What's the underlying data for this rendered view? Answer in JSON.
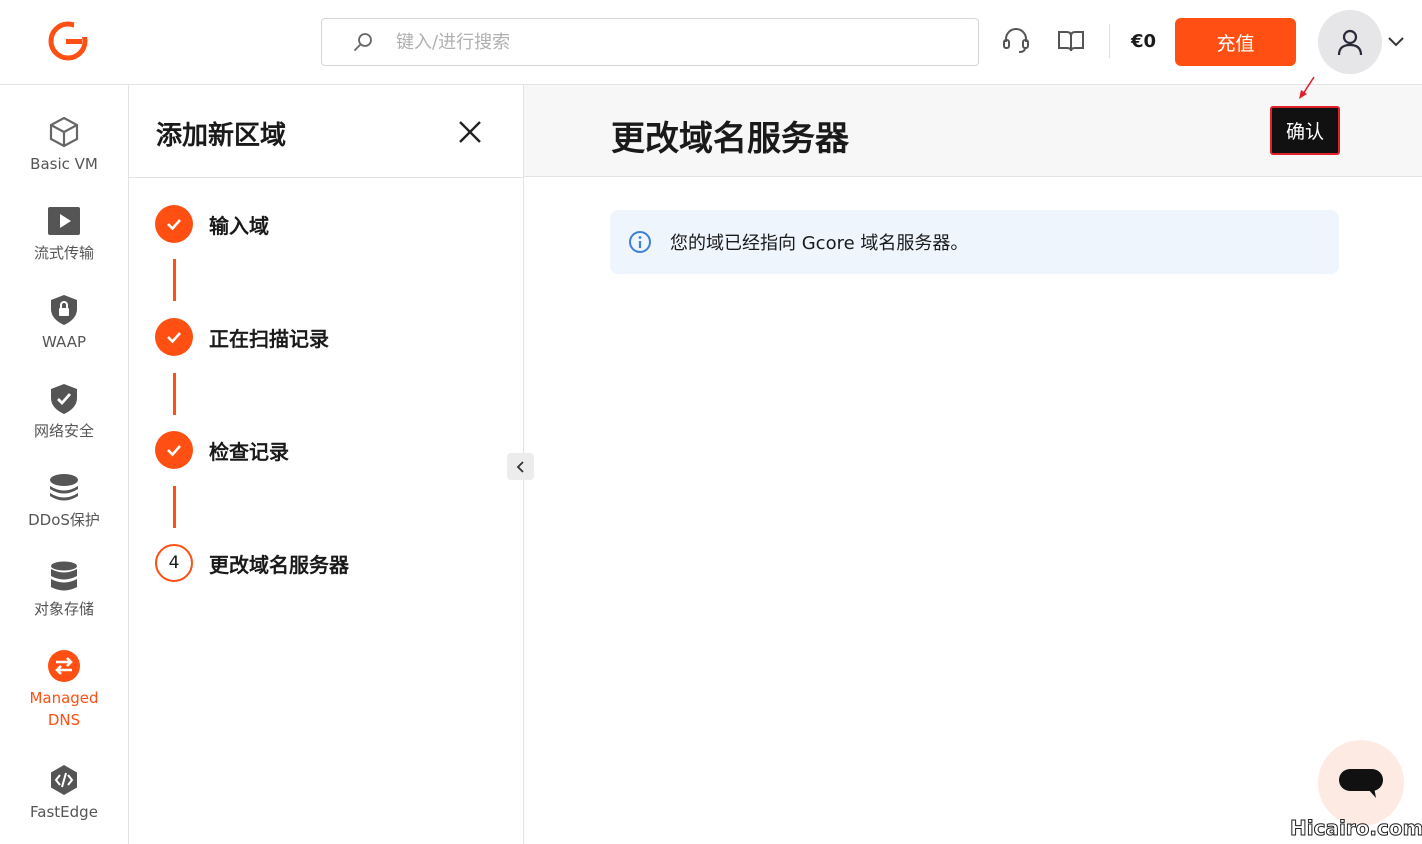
{
  "header": {
    "search_placeholder": "键入/进行搜索",
    "balance": "€0",
    "topup_label": "充值",
    "brand_color": "#ff4f12"
  },
  "nav": {
    "items": [
      {
        "label": "Basic VM",
        "icon": "cube-icon"
      },
      {
        "label": "流式传输",
        "icon": "play-icon"
      },
      {
        "label": "WAAP",
        "icon": "shield-lock-icon"
      },
      {
        "label": "网络安全",
        "icon": "shield-check-icon"
      },
      {
        "label": "DDoS保护",
        "icon": "layers-icon"
      },
      {
        "label": "对象存储",
        "icon": "database-icon"
      },
      {
        "label": "Managed DNS",
        "icon": "swap-icon",
        "active": true
      },
      {
        "label": "FastEdge",
        "icon": "code-icon"
      }
    ]
  },
  "wizard": {
    "title": "添加新区域",
    "steps": [
      {
        "label": "输入域",
        "status": "done"
      },
      {
        "label": "正在扫描记录",
        "status": "done"
      },
      {
        "label": "检查记录",
        "status": "done"
      },
      {
        "label": "更改域名服务器",
        "status": "current",
        "number": "4"
      }
    ]
  },
  "main": {
    "title": "更改域名服务器",
    "confirm_label": "确认",
    "alert_text": "您的域已经指向 Gcore 域名服务器。"
  },
  "watermark": "Hicairo.com"
}
